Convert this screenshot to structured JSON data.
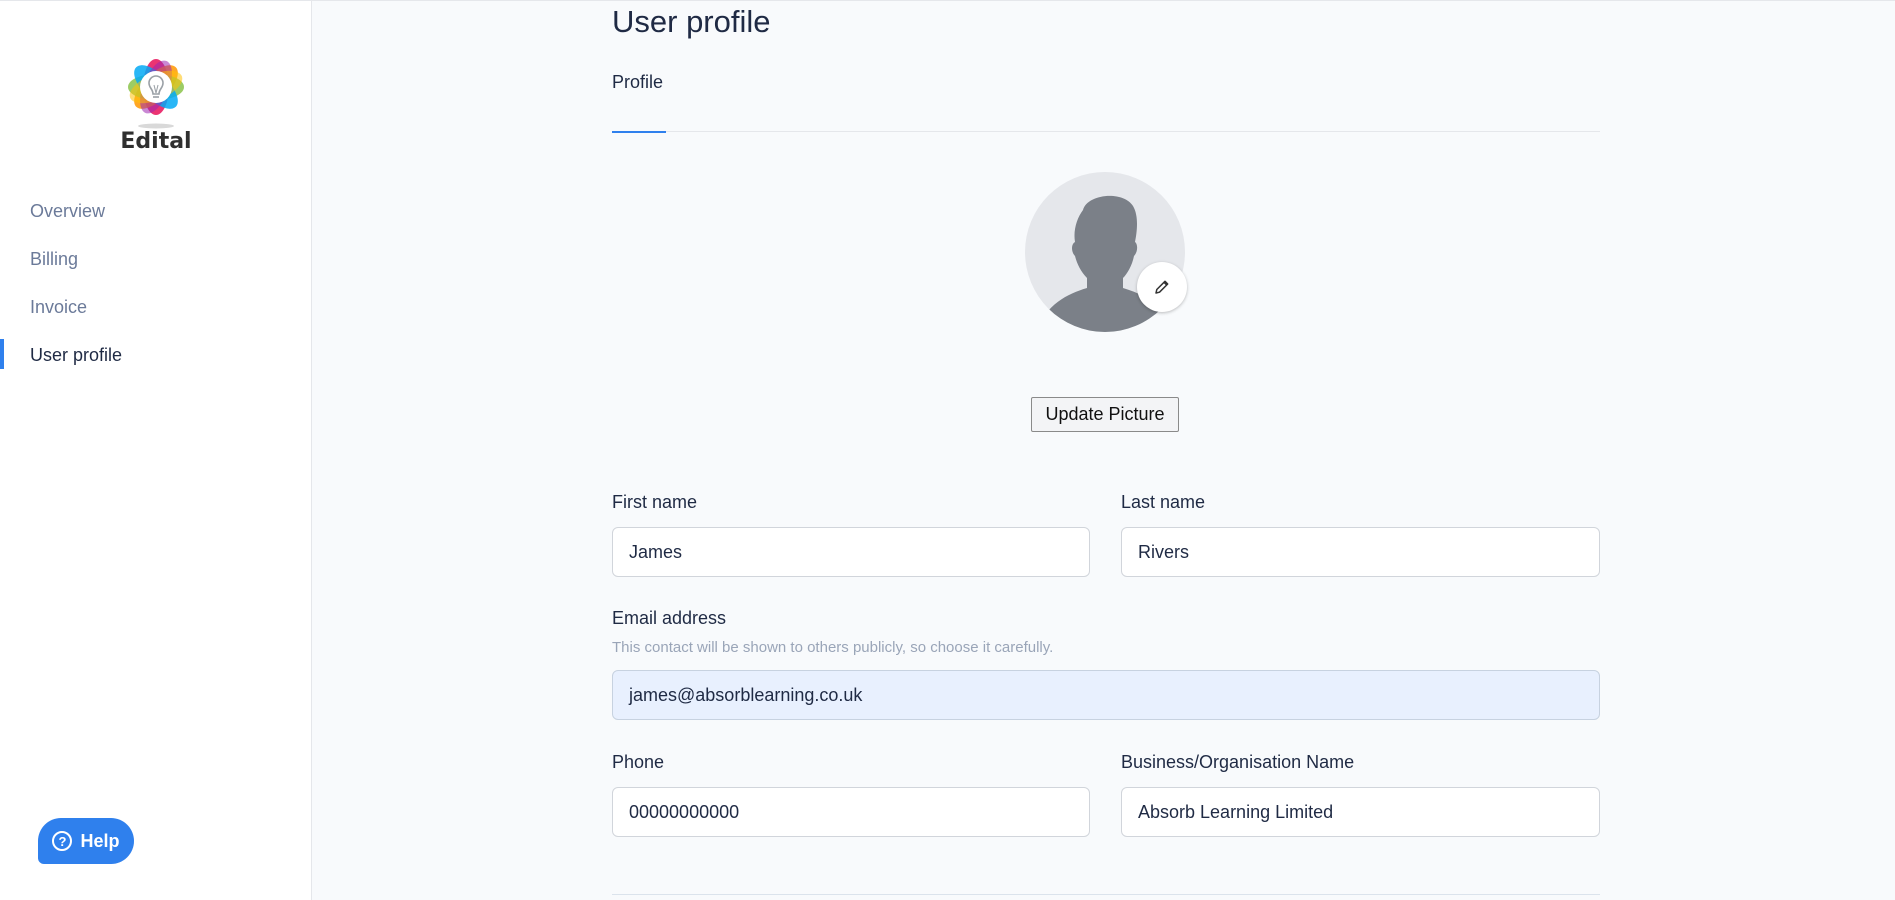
{
  "app": {
    "logo_text": "Edital"
  },
  "sidebar": {
    "items": [
      {
        "label": "Overview"
      },
      {
        "label": "Billing"
      },
      {
        "label": "Invoice"
      },
      {
        "label": "User profile",
        "active": true
      }
    ],
    "help_label": "Help"
  },
  "page": {
    "title": "User profile",
    "tabs": [
      {
        "label": "Profile",
        "active": true
      }
    ]
  },
  "avatar": {
    "update_button": "Update Picture"
  },
  "form": {
    "first_name": {
      "label": "First name",
      "value": "James"
    },
    "last_name": {
      "label": "Last name",
      "value": "Rivers"
    },
    "email": {
      "label": "Email address",
      "hint": "This contact will be shown to others publicly, so choose it carefully.",
      "value": "james@absorblearning.co.uk"
    },
    "phone": {
      "label": "Phone",
      "value": "00000000000"
    },
    "business": {
      "label": "Business/Organisation Name",
      "value": "Absorb Learning Limited"
    }
  },
  "colors": {
    "accent": "#2f80ed",
    "sidebar_text": "#6b7a99",
    "heading": "#1f2a44"
  },
  "icons": [
    "edital-logo-icon",
    "help-circle-icon",
    "pencil-icon",
    "user-silhouette-icon"
  ]
}
